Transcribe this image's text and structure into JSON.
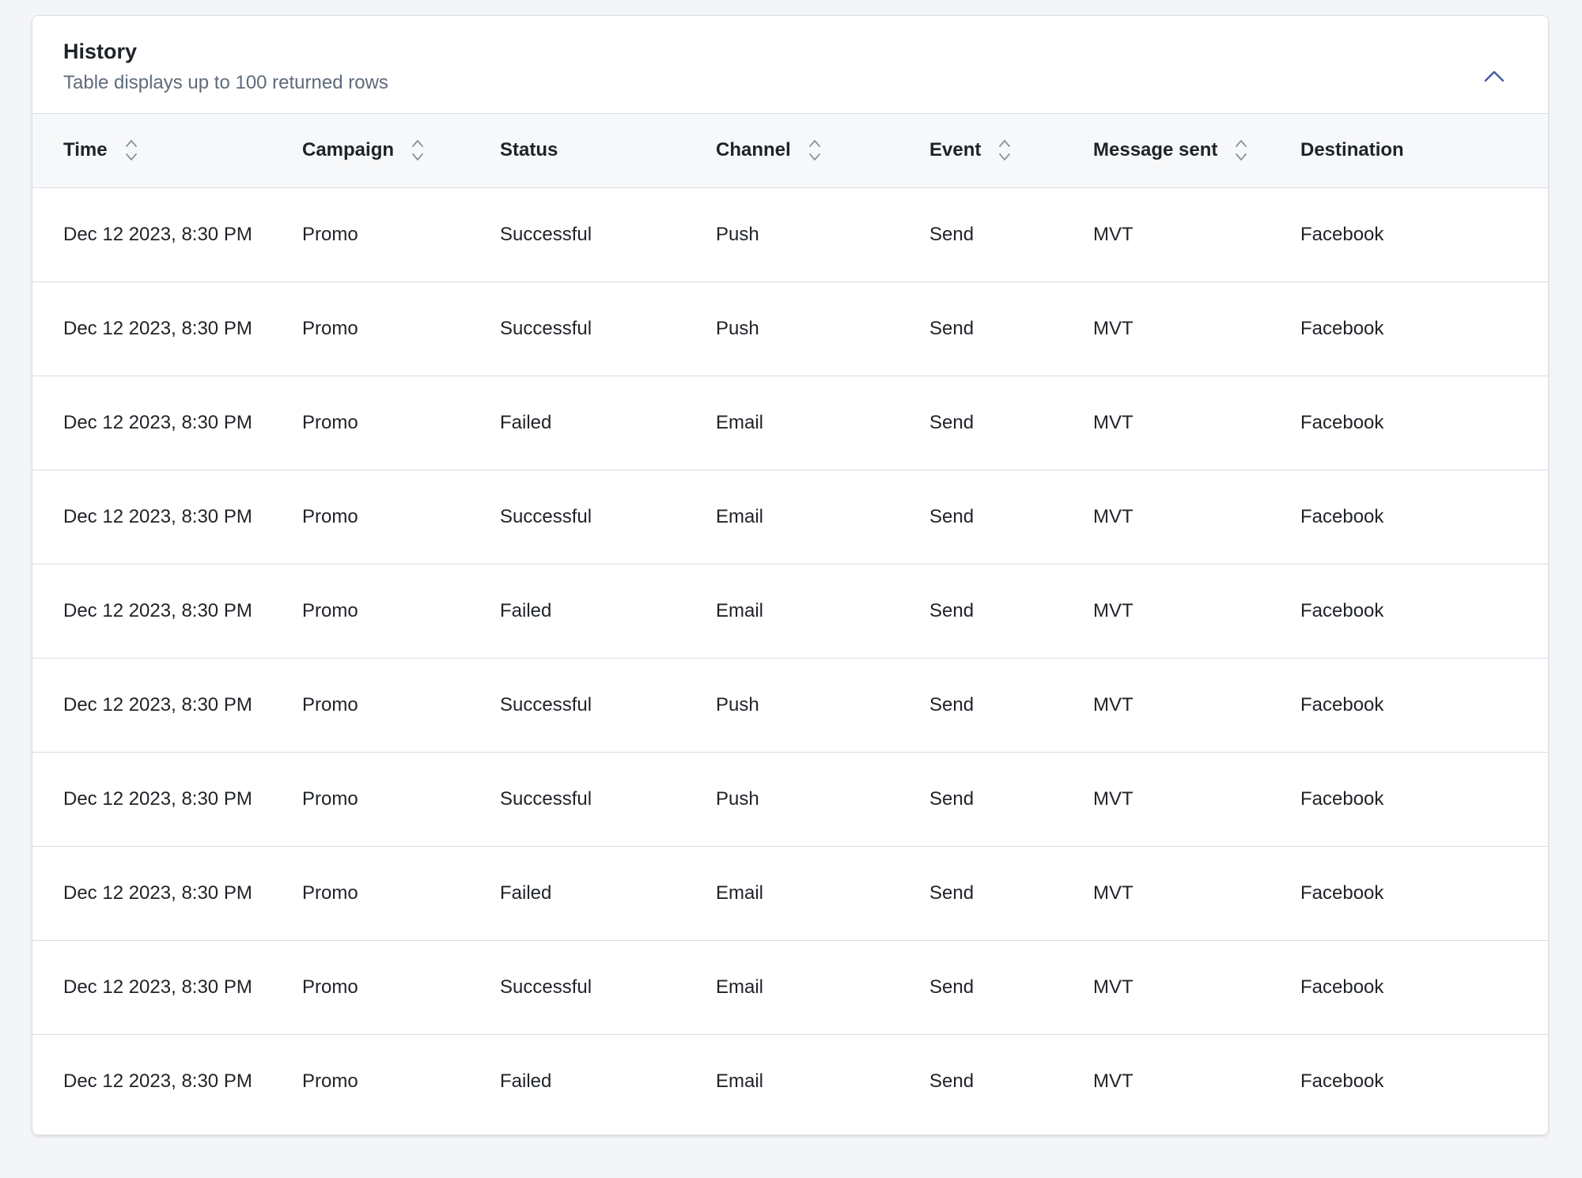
{
  "panel": {
    "title": "History",
    "subtitle": "Table displays up to 100 returned rows",
    "collapse_icon": "chevron-up-icon"
  },
  "table": {
    "columns": [
      {
        "label": "Time",
        "sortable": true
      },
      {
        "label": "Campaign",
        "sortable": true
      },
      {
        "label": "Status",
        "sortable": false
      },
      {
        "label": "Channel",
        "sortable": true
      },
      {
        "label": "Event",
        "sortable": true
      },
      {
        "label": "Message sent",
        "sortable": true
      },
      {
        "label": "Destination",
        "sortable": false
      }
    ],
    "rows": [
      [
        "Dec 12 2023, 8:30 PM",
        "Promo",
        "Successful",
        "Push",
        "Send",
        "MVT",
        "Facebook"
      ],
      [
        "Dec 12 2023, 8:30 PM",
        "Promo",
        "Successful",
        "Push",
        "Send",
        "MVT",
        "Facebook"
      ],
      [
        "Dec 12 2023, 8:30 PM",
        "Promo",
        "Failed",
        "Email",
        "Send",
        "MVT",
        "Facebook"
      ],
      [
        "Dec 12 2023, 8:30 PM",
        "Promo",
        "Successful",
        "Email",
        "Send",
        "MVT",
        "Facebook"
      ],
      [
        "Dec 12 2023, 8:30 PM",
        "Promo",
        "Failed",
        "Email",
        "Send",
        "MVT",
        "Facebook"
      ],
      [
        "Dec 12 2023, 8:30 PM",
        "Promo",
        "Successful",
        "Push",
        "Send",
        "MVT",
        "Facebook"
      ],
      [
        "Dec 12 2023, 8:30 PM",
        "Promo",
        "Successful",
        "Push",
        "Send",
        "MVT",
        "Facebook"
      ],
      [
        "Dec 12 2023, 8:30 PM",
        "Promo",
        "Failed",
        "Email",
        "Send",
        "MVT",
        "Facebook"
      ],
      [
        "Dec 12 2023, 8:30 PM",
        "Promo",
        "Successful",
        "Email",
        "Send",
        "MVT",
        "Facebook"
      ],
      [
        "Dec 12 2023, 8:30 PM",
        "Promo",
        "Failed",
        "Email",
        "Send",
        "MVT",
        "Facebook"
      ]
    ]
  },
  "colors": {
    "page_background": "#f4f5f7",
    "panel_background": "#ffffff",
    "header_row_background": "#f7f8fa",
    "border": "#d9dde3",
    "text": "#1f2328",
    "subtitle_text": "#5f6b7a",
    "accent": "#3d5fa0",
    "sort_icon": "#8a93a0"
  }
}
